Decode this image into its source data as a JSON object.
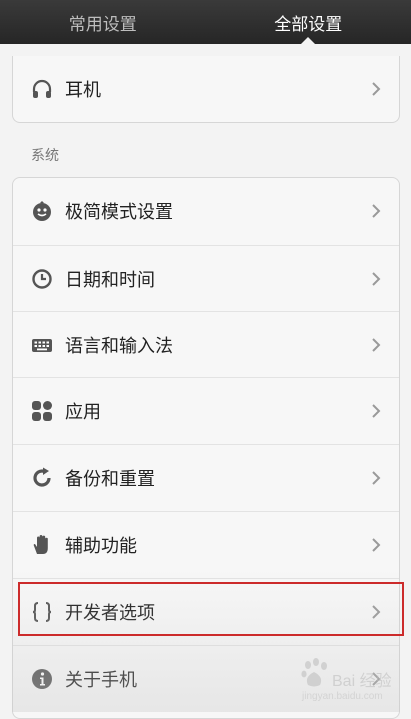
{
  "tabs": [
    {
      "label": "常用设置",
      "active": false
    },
    {
      "label": "全部设置",
      "active": true
    }
  ],
  "top_card": {
    "items": [
      {
        "label": "耳机",
        "icon": "headphones-icon"
      }
    ]
  },
  "section_system": {
    "title": "系统",
    "items": [
      {
        "label": "极简模式设置",
        "icon": "face-icon"
      },
      {
        "label": "日期和时间",
        "icon": "clock-icon"
      },
      {
        "label": "语言和输入法",
        "icon": "keyboard-icon"
      },
      {
        "label": "应用",
        "icon": "apps-grid-icon"
      },
      {
        "label": "备份和重置",
        "icon": "refresh-icon"
      },
      {
        "label": "辅助功能",
        "icon": "hand-icon"
      },
      {
        "label": "开发者选项",
        "icon": "braces-icon"
      },
      {
        "label": "关于手机",
        "icon": "info-icon"
      }
    ]
  },
  "watermark": {
    "text": "Bai 经验",
    "sub": "jingyan.baidu.com"
  },
  "colors": {
    "highlight": "#cc2b2b",
    "icon": "#555555",
    "chevron": "#9a9a9a"
  }
}
